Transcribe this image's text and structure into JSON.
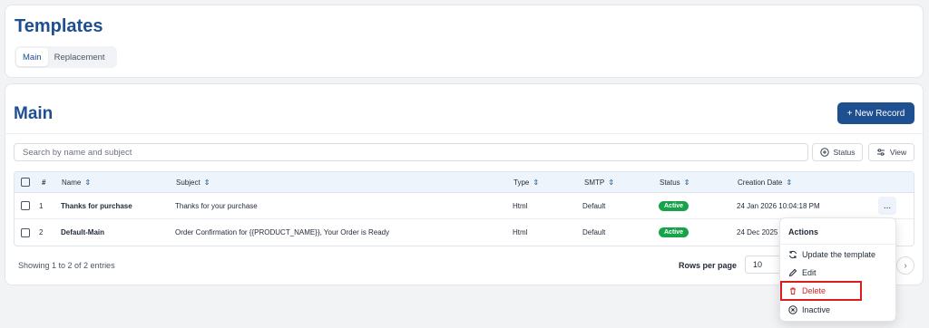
{
  "page": {
    "title": "Templates"
  },
  "tabs": [
    {
      "label": "Main",
      "active": true
    },
    {
      "label": "Replacement",
      "active": false
    }
  ],
  "section": {
    "title": "Main",
    "new_button": "+ New Record"
  },
  "search": {
    "placeholder": "Search by name and subject"
  },
  "filters": {
    "status": "Status",
    "view": "View"
  },
  "table": {
    "columns": [
      "#",
      "Name",
      "Subject",
      "Type",
      "SMTP",
      "Status",
      "Creation Date"
    ],
    "rows": [
      {
        "num": "1",
        "name": "Thanks for purchase",
        "subject": "Thanks for your purchase",
        "type": "Html",
        "smtp": "Default",
        "status": "Active",
        "date": "24 Jan 2026 10:04:18 PM"
      },
      {
        "num": "2",
        "name": "Default-Main",
        "subject": "Order Confirmation for {{PRODUCT_NAME}}, Your Order is Ready",
        "type": "Html",
        "smtp": "Default",
        "status": "Active",
        "date": "24 Dec 2025"
      }
    ],
    "row_action": "..."
  },
  "footer": {
    "showing": "Showing 1 to 2 of 2 entries",
    "rows_label": "Rows per page",
    "rows_value": "10"
  },
  "menu": {
    "title": "Actions",
    "items": {
      "update": "Update the template",
      "edit": "Edit",
      "delete": "Delete",
      "inactive": "Inactive"
    }
  },
  "colors": {
    "primary": "#1d4f91",
    "active": "#16a34a",
    "danger": "#dc2626"
  }
}
